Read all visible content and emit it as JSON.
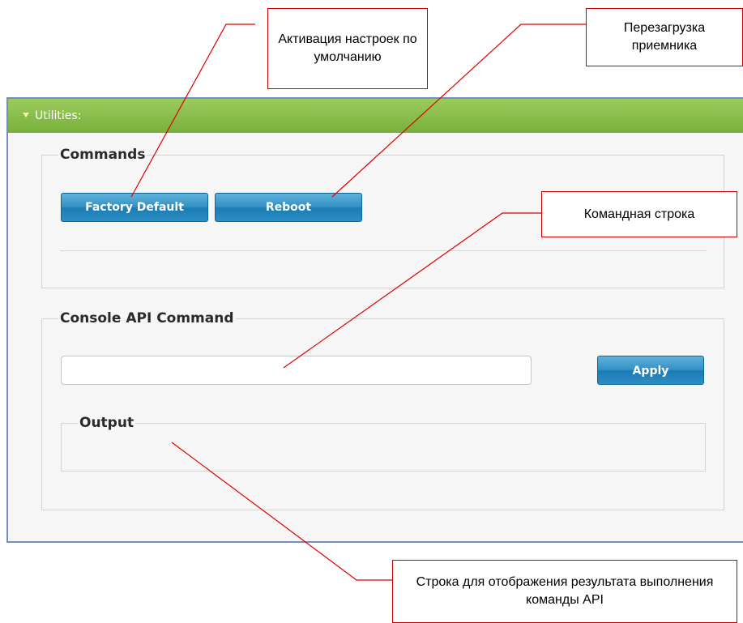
{
  "panel": {
    "title": "Utilities:"
  },
  "commands": {
    "legend": "Commands",
    "factory_default_label": "Factory Default",
    "reboot_label": "Reboot"
  },
  "console": {
    "legend": "Console API Command",
    "input_value": "",
    "input_placeholder": "",
    "apply_label": "Apply",
    "output_legend": "Output",
    "output_text": ""
  },
  "callouts": {
    "factory_default": "Активация настроек по умолчанию",
    "reboot": "Перезагрузка приемника",
    "command_line": "Командная строка",
    "output": "Строка для отображения результата выполнения команды API"
  },
  "colors": {
    "header_green": "#78b03b",
    "button_blue": "#1b7cb3",
    "callout_red": "#cc0000"
  }
}
